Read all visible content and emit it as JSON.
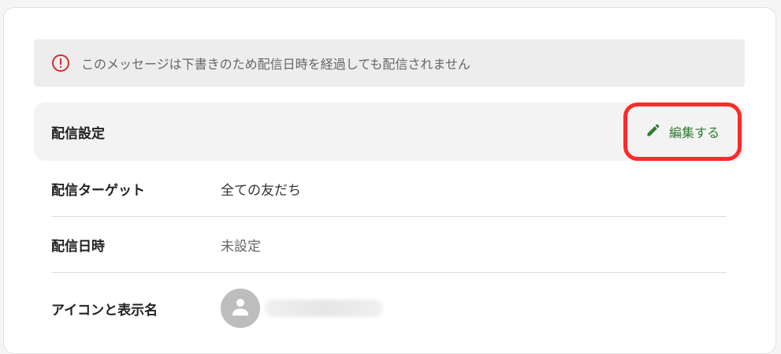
{
  "alert": {
    "icon": "exclamation-circle-icon",
    "icon_color": "#d32f2f",
    "text": "このメッセージは下書きのため配信日時を経過しても配信されません"
  },
  "section": {
    "title": "配信設定",
    "edit_label": "編集する",
    "edit_icon": "pencil-icon",
    "accent_color": "#2e7d32",
    "highlight_color": "#ff2a2a"
  },
  "rows": [
    {
      "label": "配信ターゲット",
      "value": "全ての友だち"
    },
    {
      "label": "配信日時",
      "value": "未設定"
    },
    {
      "label": "アイコンと表示名",
      "avatar_icon": "person-icon"
    }
  ]
}
